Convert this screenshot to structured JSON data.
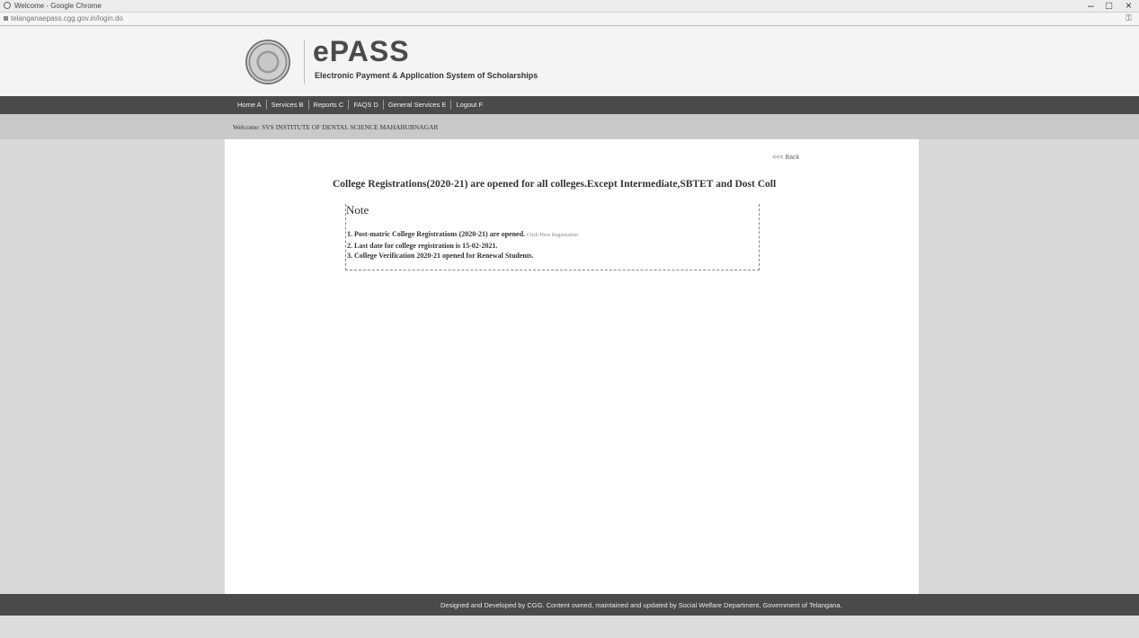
{
  "browser": {
    "title": "Welcome - Google Chrome",
    "url": "telanganaepass.cgg.gov.in/login.do",
    "controls": {
      "minimize": "–",
      "restore": "□",
      "close": "×"
    }
  },
  "header": {
    "logo_title": "ePASS",
    "logo_subtitle": "Electronic Payment & Application System of Scholarships"
  },
  "nav": {
    "items": [
      {
        "label": "Home A"
      },
      {
        "label": "Services B"
      },
      {
        "label": "Reports C"
      },
      {
        "label": "FAQS D"
      },
      {
        "label": "General Services E"
      },
      {
        "label": "Logout F"
      }
    ]
  },
  "welcome": "Welcome: SVS INSTITUTE OF DENTAL SCIENCE MAHABUBNAGAR",
  "content": {
    "back_link": "<<< Back",
    "headline": "College Registrations(2020-21) are opened for all colleges.Except Intermediate,SBTET and Dost Coll",
    "note_title": "Note",
    "notes": {
      "line1": "1. Post-matric College Registrations (2020-21) are opened.",
      "line1_link": "Click Here Registration",
      "line2": "2. Last date for college registration is 15-02-2021.",
      "line3": "3. College Verification 2020-21 opened for Renewal Students."
    }
  },
  "footer": "Designed and Developed by CGG. Content owned, maintained and updated by Social Welfare Department, Government of Telangana."
}
